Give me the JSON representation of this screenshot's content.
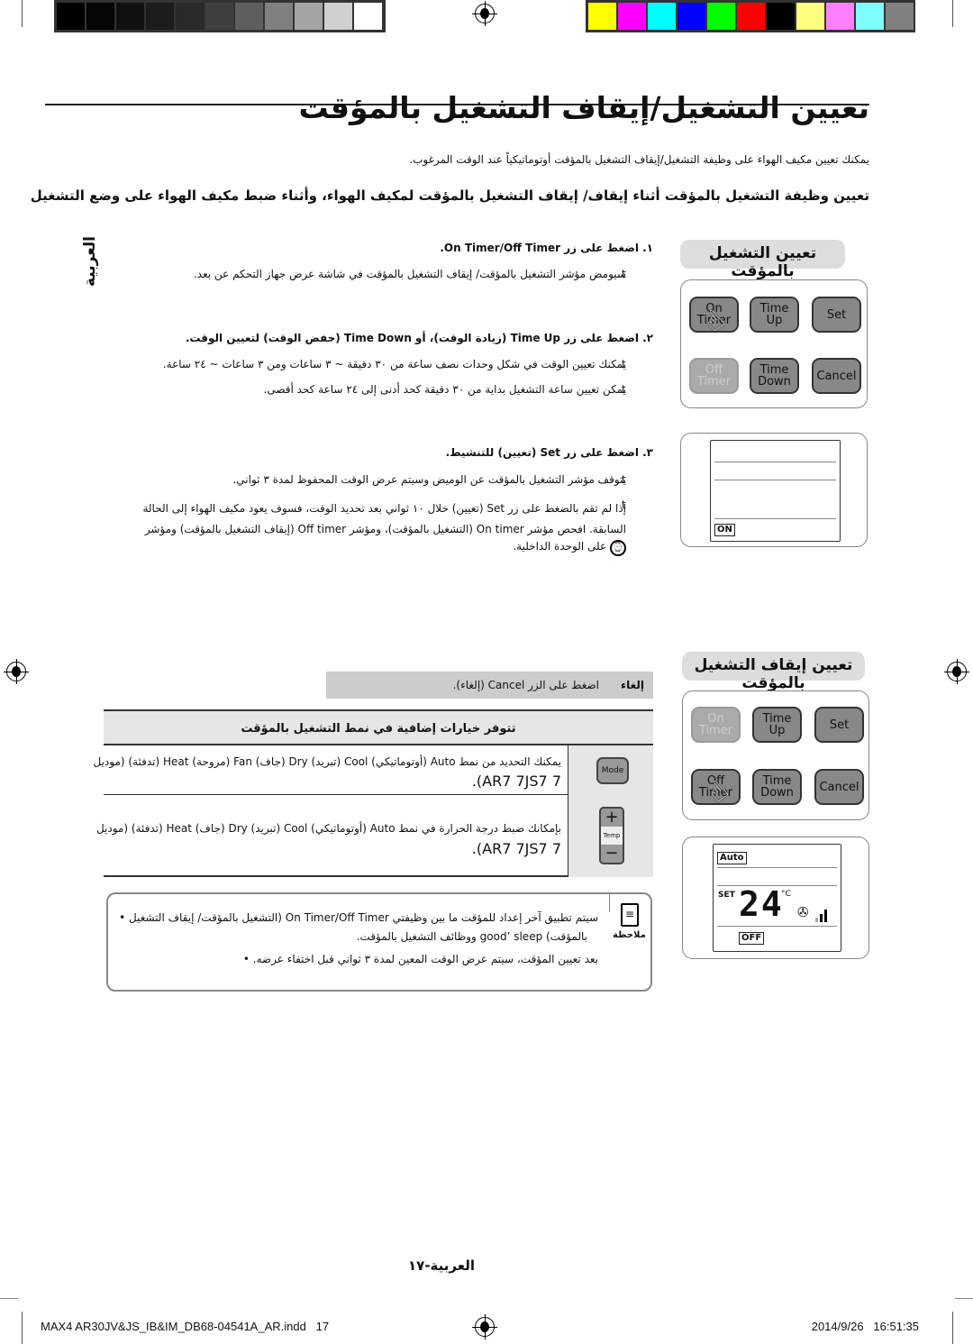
{
  "print_marks": {
    "gray_swatches": [
      "#000000",
      "#050505",
      "#101010",
      "#1c1c1c",
      "#2a2a2a",
      "#404040",
      "#5e5e5e",
      "#808080",
      "#a4a4a4",
      "#d0d0d0",
      "#ffffff"
    ],
    "color_swatches": [
      "#ffff00",
      "#ff00ff",
      "#00ffff",
      "#0000ff",
      "#00ff00",
      "#ff0000",
      "#000000",
      "#ffff80",
      "#ff80ff",
      "#80ffff",
      "#808080"
    ]
  },
  "page": {
    "title": "تعيين التشغيل/إيقاف التشغيل بالمؤقت",
    "intro": "يمكنك تعيين مكيف الهواء على وظيفة التشغيل/إيقاف التشغيل بالمؤقت أوتوماتيكياً عند الوقت المرغوب.",
    "subheading": "تعيين وظيفة التشغيل بالمؤقت أثناء إيقاف/ إيقاف التشغيل بالمؤقت لمكيف الهواء، وأثناء ضبط مكيف الهواء على وضع التشغيل",
    "side_label": "العربية",
    "page_number": "العربية-١٧"
  },
  "steps": [
    {
      "heading": "١.  اضغط على زر On Timer/Off Timer.",
      "bullets": [
        "سيومض مؤشر التشغيل بالمؤقت/ إيقاف التشغيل بالمؤقت في شاشة عرض جهاز التحكم عن بعد."
      ]
    },
    {
      "heading": "٢.  اضغط على زر Time Up (زيادة الوقت)، أو Time Down (خفض الوقت) لتعيين الوقت.",
      "bullets": [
        "يمكنك تعيين الوقت في شكل وحدات نصف ساعة من ٣٠ دقيقة ~ ٣ ساعات ومن ٣ ساعات ~ ٢٤ ساعة.",
        "يمكن تعيين ساعة التشغيل بداية من ٣٠ دقيقة كحد أدنى إلى ٢٤ ساعة كحد أقصى."
      ]
    },
    {
      "heading": "٣.  اضغط على زر Set (تعيين) للتنشيط.",
      "bullets": [
        "يتوقف مؤشر التشغيل بالمؤقت عن الوميض وسيتم عرض الوقت المحفوظ لمدة ٣ ثواني.",
        "إذا لم تقم بالضغط على زر Set (تعيين) خلال ١٠ ثواني بعد تحديد الوقت، فسوف يعود مكيف الهواء إلى الحالة السابقة. افحص مؤشر On timer (التشغيل بالمؤقت)، ومؤشر Off timer (إيقاف التشغيل بالمؤقت) ومؤشر",
        "على الوحدة الداخلية."
      ]
    }
  ],
  "bullet_glyph": "t",
  "on_timer_section": {
    "heading": "تعيين التشغيل بالمؤقت",
    "buttons": [
      "On Timer",
      "Time Up",
      "Set",
      "Off Timer",
      "Time Down",
      "Cancel"
    ],
    "display_indicator": "ON"
  },
  "off_timer_section": {
    "heading": "تعيين إيقاف التشغيل بالمؤقت",
    "buttons": [
      "On Timer",
      "Time Up",
      "Set",
      "Off Timer",
      "Time Down",
      "Cancel"
    ],
    "display_mode": "Auto",
    "display_set": "SET",
    "display_temp": "24",
    "display_unit": "°C",
    "display_indicator": "OFF"
  },
  "cancel_bar": {
    "label": "إلغاء",
    "text": "اضغط على الزر Cancel (إلغاء)."
  },
  "options_table": {
    "header": "تتوفر خيارات إضافية في نمط التشغيل بالمؤقت",
    "rows": [
      {
        "icon_label": "Mode",
        "text": "يمكنك التحديد من نمط Auto (أوتوماتيكي) Cool (تبريد) Dry (جاف) Fan (مروحة) Heat (تدفئة) (موديل",
        "text2": "AR7 7JS7 7)."
      },
      {
        "icon_label": "Temp",
        "plus": "+",
        "minus": "−",
        "text": "بإمكانك ضبط درجة الحرارة في نمط Auto (أوتوماتيكي) Cool (تبريد) Dry (جاف) Heat (تدفئة) (موديل",
        "text2": "AR7 7JS7 7)."
      }
    ]
  },
  "note": {
    "label": "ملاحظة",
    "bullets": [
      "سيتم تطبيق آخر إعداد للمؤقت ما بين وظيفتي On Timer/Off Timer (التشغيل بالمؤقت/ إيقاف التشغيل",
      "بالمؤقت) good’ sleep ووظائف التشغيل بالمؤقت.",
      "بعد تعيين المؤقت، سيتم عرض الوقت المعين لمدة ٣ ثواني قبل اختفاء عرضه."
    ]
  },
  "footer": {
    "file": "MAX4 AR30JV&JS_IB&IM_DB68-04541A_AR.indd   17",
    "timestamp": "2014/9/26   16:51:35"
  }
}
